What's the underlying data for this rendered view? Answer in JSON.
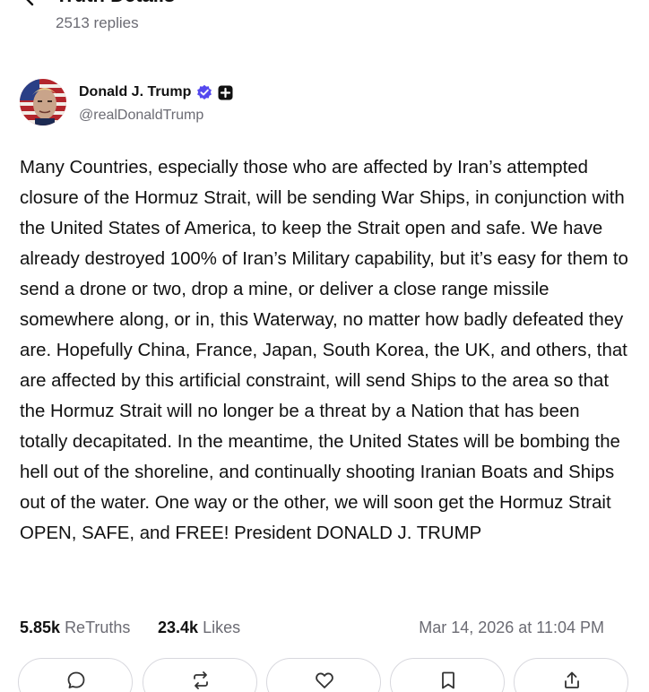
{
  "header": {
    "title": "Truth Details",
    "replies": "2513 replies"
  },
  "author": {
    "name": "Donald J. Trump",
    "handle": "@realDonaldTrump"
  },
  "post": {
    "text": "Many Countries, especially those who are affected by Iran’s attempted closure of the Hormuz Strait, will be sending War Ships, in conjunction with the United States of America, to keep the Strait open and safe. We have already destroyed 100% of Iran’s Military capability, but it’s easy for them to send a drone or two, drop a mine, or deliver a close range missile somewhere along, or in, this Waterway, no matter how badly defeated they are. Hopefully China, France, Japan, South Korea, the UK, and others, that are affected by this artificial constraint, will send Ships to the area so that the Hormuz Strait will no longer be a threat by a Nation that has been totally decapitated. In the meantime, the United States will be bombing the hell out of the shoreline, and continually shooting Iranian Boats and Ships out of the water. One way or the other, we will soon get the Hormuz Strait OPEN, SAFE, and FREE! President DONALD J. TRUMP"
  },
  "stats": {
    "retruths_count": "5.85k",
    "retruths_label": "ReTruths",
    "likes_count": "23.4k",
    "likes_label": "Likes",
    "timestamp": "Mar 14, 2026 at 11:04 PM"
  },
  "actions": [
    "reply-icon",
    "retruth-icon",
    "like-icon",
    "bookmark-icon",
    "share-icon"
  ],
  "colors": {
    "verified_badge": "#5448ee",
    "secondary_text": "#6b6b73",
    "border": "#d8d8de"
  }
}
